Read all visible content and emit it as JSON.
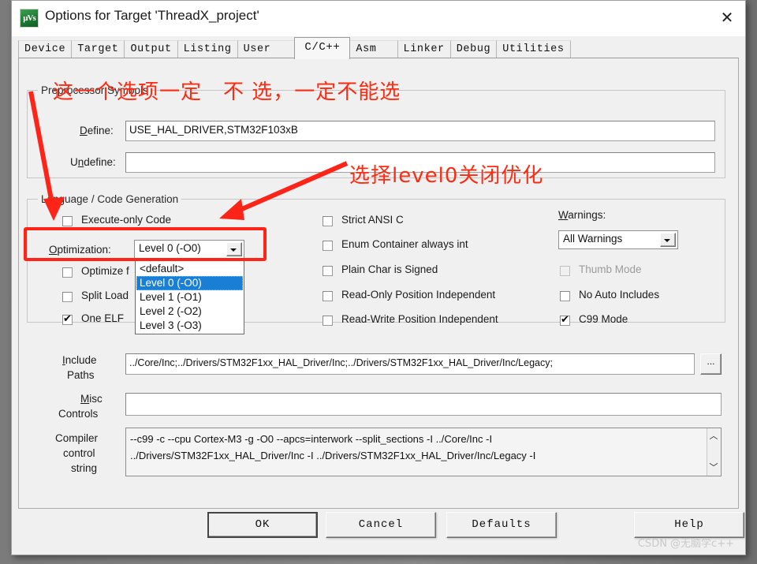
{
  "window": {
    "title": "Options for Target 'ThreadX_project'",
    "icon": "keil-uvision-icon",
    "close_label": "✕"
  },
  "tabs": [
    {
      "label": "Device",
      "active": false
    },
    {
      "label": "Target",
      "active": false
    },
    {
      "label": "Output",
      "active": false
    },
    {
      "label": "Listing",
      "active": false
    },
    {
      "label": "User",
      "active": false
    },
    {
      "label": "C/C++",
      "active": true
    },
    {
      "label": "Asm",
      "active": false
    },
    {
      "label": "Linker",
      "active": false
    },
    {
      "label": "Debug",
      "active": false
    },
    {
      "label": "Utilities",
      "active": false
    }
  ],
  "preprocessor": {
    "group_title": "Preprocessor Symbols",
    "define_label": "Define:",
    "define_value": "USE_HAL_DRIVER,STM32F103xB",
    "undefine_label": "Undefine:",
    "undefine_value": ""
  },
  "language": {
    "group_title": "Language / Code Generation",
    "left_column": [
      {
        "label": "Execute-only Code",
        "checked": false,
        "disabled": false
      },
      {
        "label": "Optimize f",
        "checked": false,
        "disabled": false
      },
      {
        "label": "Split Load",
        "checked": false,
        "disabled": false
      },
      {
        "label": "One ELF",
        "checked": true,
        "disabled": false
      }
    ],
    "optimization_label": "Optimization:",
    "optimization_value": "Level 0 (-O0)",
    "optimization_options": [
      {
        "label": "<default>",
        "selected": false
      },
      {
        "label": "Level 0 (-O0)",
        "selected": true
      },
      {
        "label": "Level 1 (-O1)",
        "selected": false
      },
      {
        "label": "Level 2 (-O2)",
        "selected": false
      },
      {
        "label": "Level 3 (-O3)",
        "selected": false
      }
    ],
    "middle_column": [
      {
        "label": "Strict ANSI C",
        "checked": false,
        "disabled": false
      },
      {
        "label": "Enum Container always int",
        "checked": false,
        "disabled": false
      },
      {
        "label": "Plain Char is Signed",
        "checked": false,
        "disabled": false
      },
      {
        "label": "Read-Only Position Independent",
        "checked": false,
        "disabled": false
      },
      {
        "label": "Read-Write Position Independent",
        "checked": false,
        "disabled": false
      }
    ],
    "warnings_label": "Warnings:",
    "warnings_value": "All Warnings",
    "right_column": [
      {
        "label": "Thumb Mode",
        "checked": false,
        "disabled": true
      },
      {
        "label": "No Auto Includes",
        "checked": false,
        "disabled": false
      },
      {
        "label": "C99 Mode",
        "checked": true,
        "disabled": false
      }
    ]
  },
  "paths": {
    "include_label_line1": "Include",
    "include_label_line2": "Paths",
    "include_value": "../Core/Inc;../Drivers/STM32F1xx_HAL_Driver/Inc;../Drivers/STM32F1xx_HAL_Driver/Inc/Legacy;",
    "browse_label": "...",
    "misc_label_line1": "Misc",
    "misc_label_line2": "Controls",
    "misc_value": "",
    "compiler_label_line1": "Compiler",
    "compiler_label_line2": "control",
    "compiler_label_line3": "string",
    "compiler_value_line1": "--c99 -c --cpu Cortex-M3 -g -O0 --apcs=interwork --split_sections -I ../Core/Inc -I",
    "compiler_value_line2": "../Drivers/STM32F1xx_HAL_Driver/Inc -I ../Drivers/STM32F1xx_HAL_Driver/Inc/Legacy -I",
    "scroll_up": "︿",
    "scroll_down": "﹀"
  },
  "footer": {
    "ok": "OK",
    "cancel": "Cancel",
    "defaults": "Defaults",
    "help": "Help"
  },
  "annotations": {
    "note_top": "这一个选项一定　不 选，一定不能选",
    "note_mid": "选择level0关闭优化",
    "accent_color": "#fe2417"
  },
  "watermark": "CSDN @无脑学c++"
}
